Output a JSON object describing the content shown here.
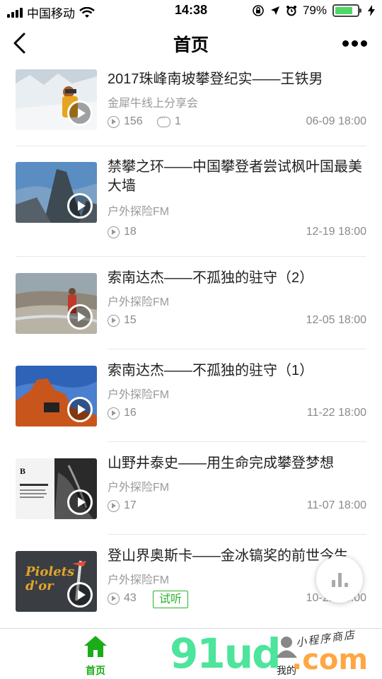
{
  "status_bar": {
    "carrier": "中国移动",
    "time": "14:38",
    "battery_percent": "79%",
    "battery_level": 0.79,
    "battery_color": "#4cd964",
    "icons": [
      "signal-icon",
      "wifi-icon",
      "orientation-lock-icon",
      "location-icon",
      "alarm-icon",
      "battery-icon",
      "charging-icon"
    ]
  },
  "nav": {
    "title": "首页",
    "back_icon": "chevron-left-icon",
    "more_icon": "more-dots-icon"
  },
  "accent_color": "#1aad19",
  "items": [
    {
      "title": "2017珠峰南坡攀登纪实——王铁男",
      "source": "金犀牛线上分享会",
      "plays": "156",
      "comments": "1",
      "date": "06-09 18:00",
      "thumb": "mountaineer-on-glacier"
    },
    {
      "title": "禁攀之环——中国攀登者尝试枫叶国最美大墙",
      "source": "户外探险FM",
      "plays": "18",
      "date": "12-19 18:00",
      "thumb": "rock-wall"
    },
    {
      "title": "索南达杰——不孤独的驻守（2）",
      "source": "户外探险FM",
      "plays": "15",
      "date": "12-05 18:00",
      "thumb": "plateau-river"
    },
    {
      "title": "索南达杰——不孤独的驻守（1）",
      "source": "户外探险FM",
      "plays": "16",
      "date": "11-22 18:00",
      "thumb": "red-monument"
    },
    {
      "title": "山野井泰史——用生命完成攀登梦想",
      "source": "户外探险FM",
      "plays": "17",
      "date": "11-07 18:00",
      "thumb": "book-cover"
    },
    {
      "title": "登山界奥斯卡——金冰镐奖的前世今生",
      "source": "户外探险FM",
      "plays": "43",
      "tag": "试听",
      "date": "10-21 18:00",
      "thumb": "piolets-dor-logo",
      "thumb_text": "Piolets d'or"
    }
  ],
  "tabs": [
    {
      "label": "首页",
      "icon": "home-icon",
      "active": true
    },
    {
      "label": "我的",
      "icon": "user-icon",
      "active": false
    }
  ],
  "watermark": {
    "main": "91ud",
    "suffix": ".com",
    "small": "小程序商店"
  }
}
